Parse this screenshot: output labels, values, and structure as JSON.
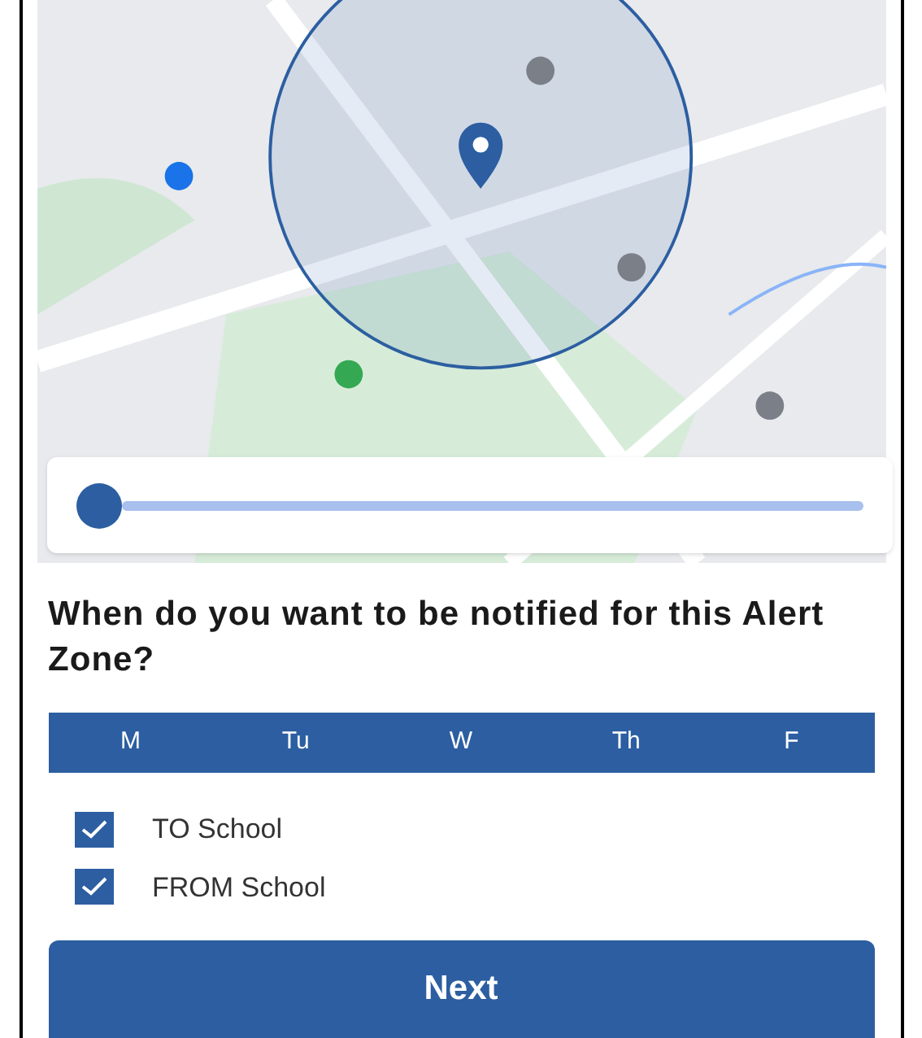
{
  "zone_slider": {
    "level": 0.0
  },
  "question": "When do you want to be notified for this Alert Zone?",
  "days": [
    {
      "label": "M",
      "selected": true
    },
    {
      "label": "Tu",
      "selected": true
    },
    {
      "label": "W",
      "selected": true
    },
    {
      "label": "Th",
      "selected": true
    },
    {
      "label": "F",
      "selected": true
    }
  ],
  "trips": [
    {
      "label": "TO School",
      "checked": true
    },
    {
      "label": "FROM School",
      "checked": true
    }
  ],
  "next_button": "Next"
}
